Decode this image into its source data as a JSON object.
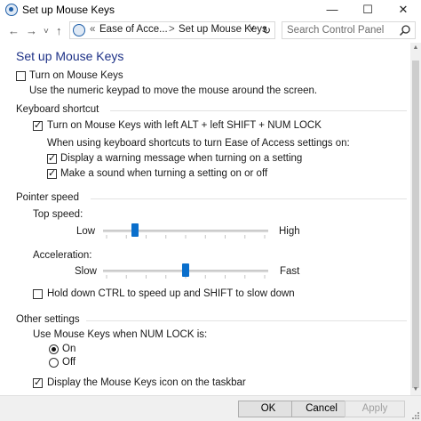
{
  "window": {
    "title": "Set up Mouse Keys",
    "minimize_glyph": "—",
    "maximize_glyph": "☐",
    "close_glyph": "✕"
  },
  "nav": {
    "back_glyph": "←",
    "forward_glyph": "→",
    "recent_glyph": "˅",
    "up_glyph": "↑",
    "breadcrumb_chevron": "«",
    "breadcrumb": [
      "Ease of Acce...",
      "Set up Mouse Keys"
    ],
    "separator": ">",
    "dropdown_glyph": "˅",
    "refresh_glyph": "↻",
    "search_placeholder": "Search Control Panel"
  },
  "page": {
    "title": "Set up Mouse Keys",
    "turn_on": {
      "label": "Turn on Mouse Keys",
      "checked": false
    },
    "turn_on_desc": "Use the numeric keypad to move the mouse around the screen.",
    "keyboard_shortcut": {
      "heading": "Keyboard shortcut",
      "shortcut": {
        "label": "Turn on Mouse Keys with left ALT + left SHIFT + NUM LOCK",
        "checked": true
      },
      "when_using": "When using keyboard shortcuts to turn Ease of Access settings on:",
      "warning": {
        "label": "Display a warning message when turning on a setting",
        "checked": true
      },
      "sound": {
        "label": "Make a sound when turning a setting on or off",
        "checked": true
      }
    },
    "pointer_speed": {
      "heading": "Pointer speed",
      "top_speed": {
        "label": "Top speed:",
        "low": "Low",
        "high": "High",
        "value": 0.18
      },
      "acceleration": {
        "label": "Acceleration:",
        "slow": "Slow",
        "fast": "Fast",
        "value": 0.5
      },
      "hold_ctrl": {
        "label": "Hold down CTRL to speed up and SHIFT to slow down",
        "checked": false
      }
    },
    "other_settings": {
      "heading": "Other settings",
      "num_lock_label": "Use Mouse Keys when NUM LOCK is:",
      "options": [
        {
          "label": "On",
          "selected": true
        },
        {
          "label": "Off",
          "selected": false
        }
      ],
      "taskbar_icon": {
        "label": "Display the Mouse Keys icon on the taskbar",
        "checked": true
      }
    }
  },
  "footer": {
    "ok": "OK",
    "cancel": "Cancel",
    "apply": "Apply"
  },
  "colors": {
    "title_blue": "#1e3287",
    "slider_thumb": "#0a6fcc"
  }
}
